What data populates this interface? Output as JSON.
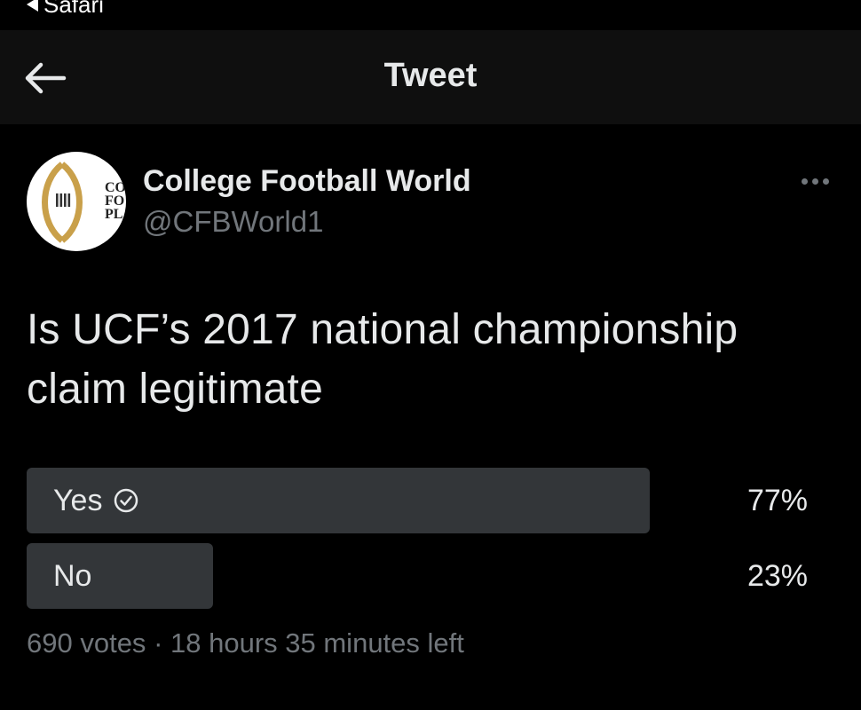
{
  "status_bar": {
    "back_app": "Safari"
  },
  "header": {
    "title": "Tweet"
  },
  "author": {
    "name": "College Football World",
    "handle": "@CFBWorld1",
    "avatar_text_lines": [
      "CO",
      "FO",
      "PL"
    ]
  },
  "tweet": {
    "line1": "Is UCF’s 2017 national championship",
    "line2": "claim legitimate"
  },
  "poll": {
    "options": [
      {
        "label": "Yes",
        "percent": "77%",
        "value": 0.77,
        "selected": true
      },
      {
        "label": "No",
        "percent": "23%",
        "value": 0.23,
        "selected": false
      }
    ],
    "votes": "690 votes",
    "separator": "·",
    "time_left": "18 hours 35 minutes left"
  },
  "colors": {
    "background": "#000000",
    "header_bg": "#0f0f0f",
    "poll_bar": "#333639",
    "text_primary": "#e7e9ea",
    "text_secondary": "#71767b",
    "logo_gold": "#c9a04a"
  },
  "icons": [
    "back-triangle-icon",
    "back-arrow-icon",
    "more-icon",
    "check-circle-icon"
  ]
}
